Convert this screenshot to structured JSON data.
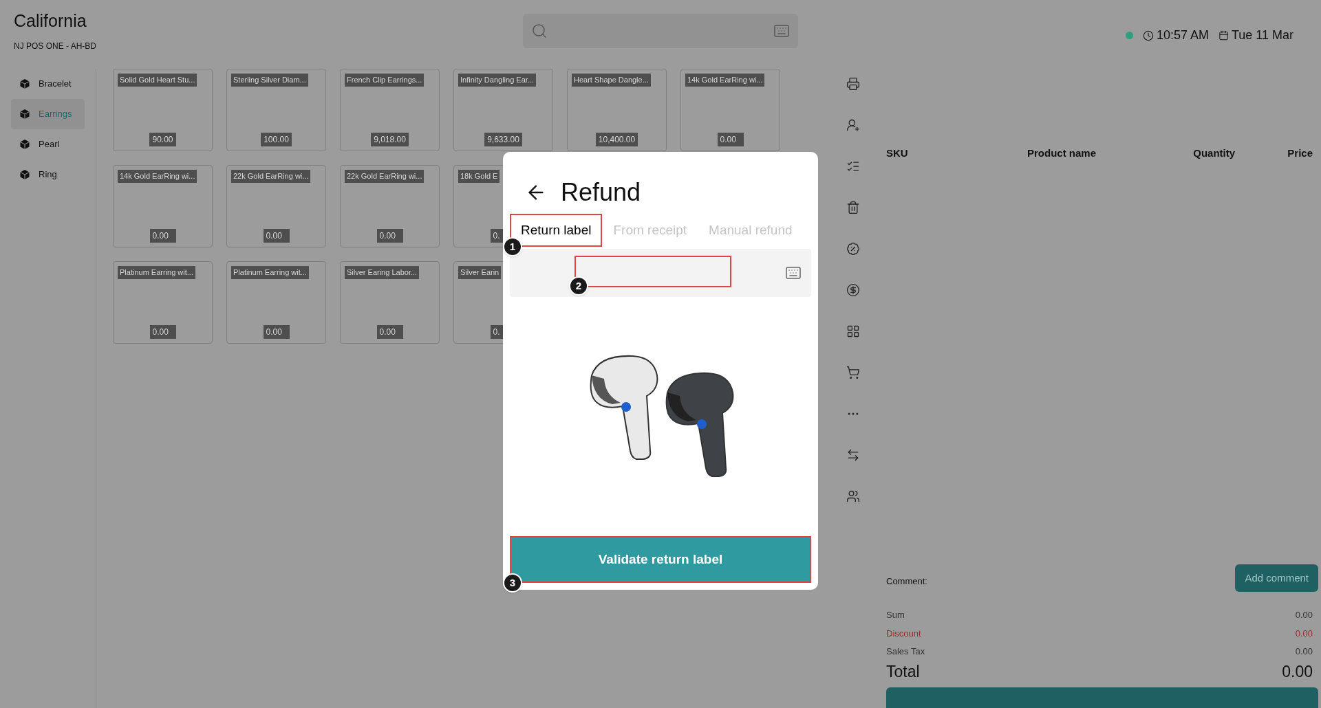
{
  "header": {
    "title": "California",
    "subtitle": "NJ POS ONE - AH-BD",
    "online": true,
    "time": "10:57 AM",
    "date": "Tue 11 Mar"
  },
  "categories": [
    {
      "label": "Bracelet",
      "selected": false
    },
    {
      "label": "Earrings",
      "selected": true
    },
    {
      "label": "Pearl",
      "selected": false
    },
    {
      "label": "Ring",
      "selected": false
    }
  ],
  "product_rows": [
    [
      {
        "name": "Solid Gold Heart Stu...",
        "price": "90.00"
      },
      {
        "name": "Sterling Silver Diam...",
        "price": "100.00"
      },
      {
        "name": "French Clip Earrings...",
        "price": "9,018.00"
      },
      {
        "name": "Infinity Dangling Ear...",
        "price": "9,633.00"
      },
      {
        "name": "Heart Shape Dangle...",
        "price": "10,400.00"
      },
      {
        "name": "14k Gold EarRing wi...",
        "price": "0.00"
      }
    ],
    [
      {
        "name": "14k Gold EarRing wi...",
        "price": "0.00"
      },
      {
        "name": "22k Gold EarRing wi...",
        "price": "0.00"
      },
      {
        "name": "22k Gold EarRing wi...",
        "price": "0.00"
      },
      {
        "name": "18k Gold E",
        "price": "0."
      }
    ],
    [
      {
        "name": "Platinum Earring wit...",
        "price": "0.00"
      },
      {
        "name": "Platinum Earring wit...",
        "price": "0.00"
      },
      {
        "name": "Silver Earing Labor...",
        "price": "0.00"
      },
      {
        "name": "Silver Earin",
        "price": "0."
      }
    ]
  ],
  "order_table": {
    "columns": [
      "SKU",
      "Product name",
      "Quantity",
      "Price"
    ]
  },
  "comment": {
    "label": "Comment:",
    "button": "Add comment"
  },
  "totals": [
    {
      "label": "Sum",
      "value": "0.00",
      "kind": "normal"
    },
    {
      "label": "Discount",
      "value": "0.00",
      "kind": "discount"
    },
    {
      "label": "Sales Tax",
      "value": "0.00",
      "kind": "normal"
    }
  ],
  "total": {
    "label": "Total",
    "value": "0.00"
  },
  "refund_dialog": {
    "title": "Refund",
    "tabs": [
      {
        "label": "Return label",
        "selected": true,
        "callout": "1"
      },
      {
        "label": "From receipt",
        "selected": false
      },
      {
        "label": "Manual refund",
        "selected": false
      }
    ],
    "field": {
      "callout": "2"
    },
    "button": {
      "label": "Validate return label",
      "callout": "3"
    }
  }
}
